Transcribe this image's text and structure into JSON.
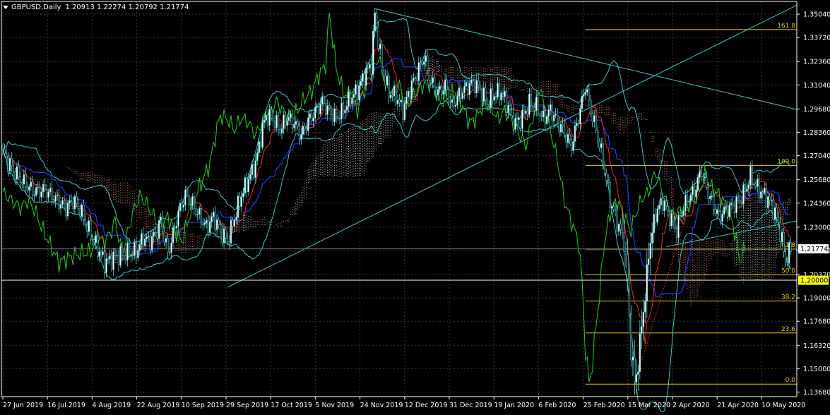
{
  "header": {
    "symbol": "GBPUSD,Daily",
    "ohlc": "1.20913 1.22274 1.20792 1.21774"
  },
  "colors": {
    "background": "#000000",
    "grid": "#3a3a3a",
    "axis_text": "#ffffff",
    "bull_candle": "#ffffff",
    "bear_candle": "#000000",
    "candle_outline": "#5fd7d7",
    "bollinger": "#40c8c8",
    "tenkan": "#ff2020",
    "kijun": "#1a3cff",
    "chikou": "#20d020",
    "kumo_bull": "#ffffff",
    "kumo_bear": "#ff9a8a",
    "trendline": "#40c8c8",
    "fibo": "#e8d000",
    "fibo_base": "#ff2020",
    "current_price_bg": "#ffffff",
    "level_120_bg": "#ffff00"
  },
  "chart_data": {
    "type": "candlestick",
    "symbol": "GBPUSD",
    "timeframe": "Daily",
    "ylim": [
      1.1342,
      1.3576
    ],
    "y_ticks": [
      "1.35040",
      "1.33720",
      "1.32360",
      "1.31040",
      "1.29680",
      "1.28360",
      "1.27040",
      "1.25680",
      "1.24360",
      "1.23000",
      "1.21680",
      "1.20320",
      "1.19000",
      "1.17680",
      "1.16320",
      "1.15000",
      "1.13680"
    ],
    "x_ticks": [
      "27 Jun 2019",
      "16 Jul 2019",
      "4 Aug 2019",
      "22 Aug 2019",
      "10 Sep 2019",
      "29 Sep 2019",
      "17 Oct 2019",
      "5 Nov 2019",
      "24 Nov 2019",
      "12 Dec 2019",
      "31 Dec 2019",
      "19 Jan 2020",
      "6 Feb 2020",
      "25 Feb 2020",
      "15 Mar 2020",
      "2 Apr 2020",
      "21 Apr 2020",
      "10 May 2020"
    ],
    "current_price": "1.21774",
    "level_line": "1.20000",
    "fibonacci": [
      {
        "label": "161.8",
        "price": 1.3417
      },
      {
        "label": "100.0",
        "price": 1.2649
      },
      {
        "label": "61.8",
        "price": 1.2176
      },
      {
        "label": "50.0",
        "price": 1.2031
      },
      {
        "label": "38.2",
        "price": 1.1883
      },
      {
        "label": "23.6",
        "price": 1.1702
      },
      {
        "label": "0.0",
        "price": 1.1413
      }
    ],
    "indicators": [
      "Ichimoku Kinko Hyo",
      "Bollinger Bands",
      "Trendlines",
      "Fibonacci Retracement"
    ],
    "price_path": [
      [
        0,
        1.272
      ],
      [
        6,
        1.262
      ],
      [
        12,
        1.255
      ],
      [
        18,
        1.25
      ],
      [
        24,
        1.251
      ],
      [
        30,
        1.246
      ],
      [
        36,
        1.241
      ],
      [
        40,
        1.245
      ],
      [
        44,
        1.24
      ],
      [
        48,
        1.23
      ],
      [
        52,
        1.222
      ],
      [
        58,
        1.21
      ],
      [
        64,
        1.213
      ],
      [
        70,
        1.215
      ],
      [
        76,
        1.216
      ],
      [
        80,
        1.224
      ],
      [
        84,
        1.222
      ],
      [
        88,
        1.228
      ],
      [
        90,
        1.234
      ],
      [
        94,
        1.215
      ],
      [
        96,
        1.222
      ],
      [
        100,
        1.238
      ],
      [
        104,
        1.248
      ],
      [
        108,
        1.243
      ],
      [
        112,
        1.236
      ],
      [
        116,
        1.23
      ],
      [
        120,
        1.236
      ],
      [
        124,
        1.228
      ],
      [
        128,
        1.222
      ],
      [
        132,
        1.235
      ],
      [
        136,
        1.248
      ],
      [
        140,
        1.257
      ],
      [
        144,
        1.266
      ],
      [
        148,
        1.286
      ],
      [
        150,
        1.293
      ],
      [
        154,
        1.291
      ],
      [
        158,
        1.285
      ],
      [
        162,
        1.292
      ],
      [
        166,
        1.289
      ],
      [
        170,
        1.282
      ],
      [
        174,
        1.29
      ],
      [
        178,
        1.295
      ],
      [
        182,
        1.301
      ],
      [
        186,
        1.295
      ],
      [
        190,
        1.292
      ],
      [
        194,
        1.296
      ],
      [
        198,
        1.303
      ],
      [
        202,
        1.307
      ],
      [
        206,
        1.316
      ],
      [
        210,
        1.322
      ],
      [
        212,
        1.351
      ],
      [
        216,
        1.32
      ],
      [
        220,
        1.306
      ],
      [
        224,
        1.304
      ],
      [
        228,
        1.296
      ],
      [
        232,
        1.308
      ],
      [
        236,
        1.317
      ],
      [
        240,
        1.326
      ],
      [
        244,
        1.312
      ],
      [
        248,
        1.306
      ],
      [
        252,
        1.31
      ],
      [
        256,
        1.298
      ],
      [
        260,
        1.305
      ],
      [
        264,
        1.309
      ],
      [
        268,
        1.312
      ],
      [
        272,
        1.308
      ],
      [
        276,
        1.3
      ],
      [
        280,
        1.305
      ],
      [
        284,
        1.306
      ],
      [
        288,
        1.298
      ],
      [
        292,
        1.289
      ],
      [
        296,
        1.292
      ],
      [
        300,
        1.3
      ],
      [
        304,
        1.298
      ],
      [
        308,
        1.291
      ],
      [
        312,
        1.296
      ],
      [
        316,
        1.29
      ],
      [
        320,
        1.283
      ],
      [
        324,
        1.276
      ],
      [
        328,
        1.292
      ],
      [
        332,
        1.31
      ],
      [
        334,
        1.3
      ],
      [
        338,
        1.285
      ],
      [
        342,
        1.268
      ],
      [
        346,
        1.245
      ],
      [
        350,
        1.233
      ],
      [
        354,
        1.222
      ],
      [
        356,
        1.2
      ],
      [
        358,
        1.16
      ],
      [
        360,
        1.143
      ],
      [
        362,
        1.152
      ],
      [
        364,
        1.176
      ],
      [
        366,
        1.19
      ],
      [
        368,
        1.216
      ],
      [
        372,
        1.238
      ],
      [
        376,
        1.245
      ],
      [
        380,
        1.236
      ],
      [
        384,
        1.228
      ],
      [
        386,
        1.236
      ],
      [
        390,
        1.246
      ],
      [
        394,
        1.25
      ],
      [
        398,
        1.262
      ],
      [
        400,
        1.255
      ],
      [
        404,
        1.244
      ],
      [
        408,
        1.236
      ],
      [
        412,
        1.24
      ],
      [
        416,
        1.242
      ],
      [
        420,
        1.245
      ],
      [
        424,
        1.253
      ],
      [
        426,
        1.259
      ],
      [
        430,
        1.252
      ],
      [
        434,
        1.248
      ],
      [
        438,
        1.243
      ],
      [
        442,
        1.232
      ],
      [
        444,
        1.222
      ],
      [
        446,
        1.211
      ],
      [
        449,
        1.218
      ]
    ]
  }
}
